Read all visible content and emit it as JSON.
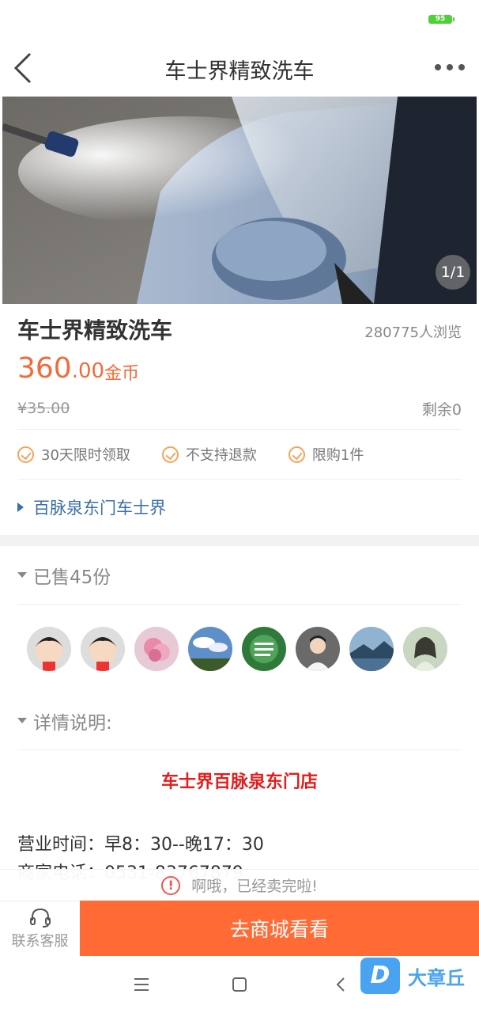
{
  "status_bar": {
    "battery": "95"
  },
  "nav": {
    "title": "车士界精致洗车"
  },
  "hero": {
    "counter": "1/1"
  },
  "product": {
    "title": "车士界精致洗车",
    "views": "280775人浏览",
    "price_int": "360",
    "price_dec": ".00",
    "price_unit": "金币",
    "original_price": "¥35.00",
    "remaining": "剩余0",
    "tags": [
      "30天限时领取",
      "不支持退款",
      "限购1件"
    ],
    "store": "百脉泉东门车士界"
  },
  "sold_section": {
    "title": "已售45份"
  },
  "detail_section": {
    "title": "详情说明:",
    "shop_heading": "车士界百脉泉东门店",
    "hours": "营业时间：早8：30--晚17：30",
    "phone": "商家电话：0531-83767879"
  },
  "soldout_notice": {
    "icon": "!",
    "text": "啊哦，已经卖完啦!"
  },
  "bottom": {
    "cs_label": "联系客服",
    "mall_button": "去商城看看"
  },
  "watermark": {
    "logo": "D",
    "text": "大章丘"
  },
  "colors": {
    "accent": "#ff6a35",
    "price": "#f26a3a",
    "link": "#3a6ea8",
    "shop_heading": "#e51c1c"
  }
}
